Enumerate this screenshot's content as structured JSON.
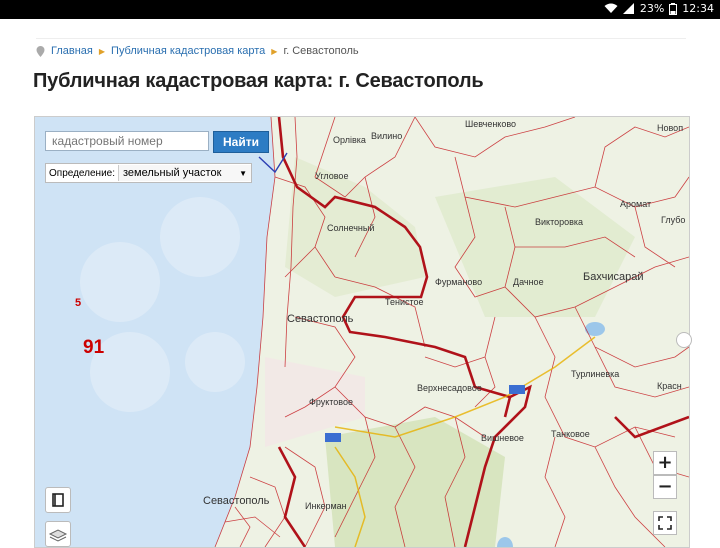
{
  "statusbar": {
    "battery": "23%",
    "time": "12:34"
  },
  "breadcrumb": {
    "items": [
      "Главная",
      "Публичная кадастровая карта",
      "г. Севастополь"
    ]
  },
  "page": {
    "title": "Публичная кадастровая карта: г. Севастополь"
  },
  "search": {
    "placeholder": "кадастровый номер",
    "button": "Найти"
  },
  "definition": {
    "label": "Определение:",
    "selected": "земельный участок"
  },
  "zoom": {
    "in": "+",
    "out": "−"
  },
  "map": {
    "places": [
      "Шевченково",
      "Новоп",
      "Вилино",
      "Орлiвка",
      "Угловое",
      "Аромат",
      "Викторовка",
      "Глубо",
      "Солнечный",
      "Бахчисарай",
      "Фурманово",
      "Дачное",
      "Тенистое",
      "Севастополь",
      "Верхнесадовое",
      "Турлиневка",
      "Фруктовое",
      "Танковое",
      "Вишневое",
      "Красн",
      "Севастополь",
      "Инкерман"
    ],
    "region_labels": [
      "5",
      "91"
    ]
  },
  "colors": {
    "accent": "#2d7cc4",
    "boundary": "#c4161c",
    "sea": "#cfe3f5",
    "land": "#eef2e4"
  }
}
